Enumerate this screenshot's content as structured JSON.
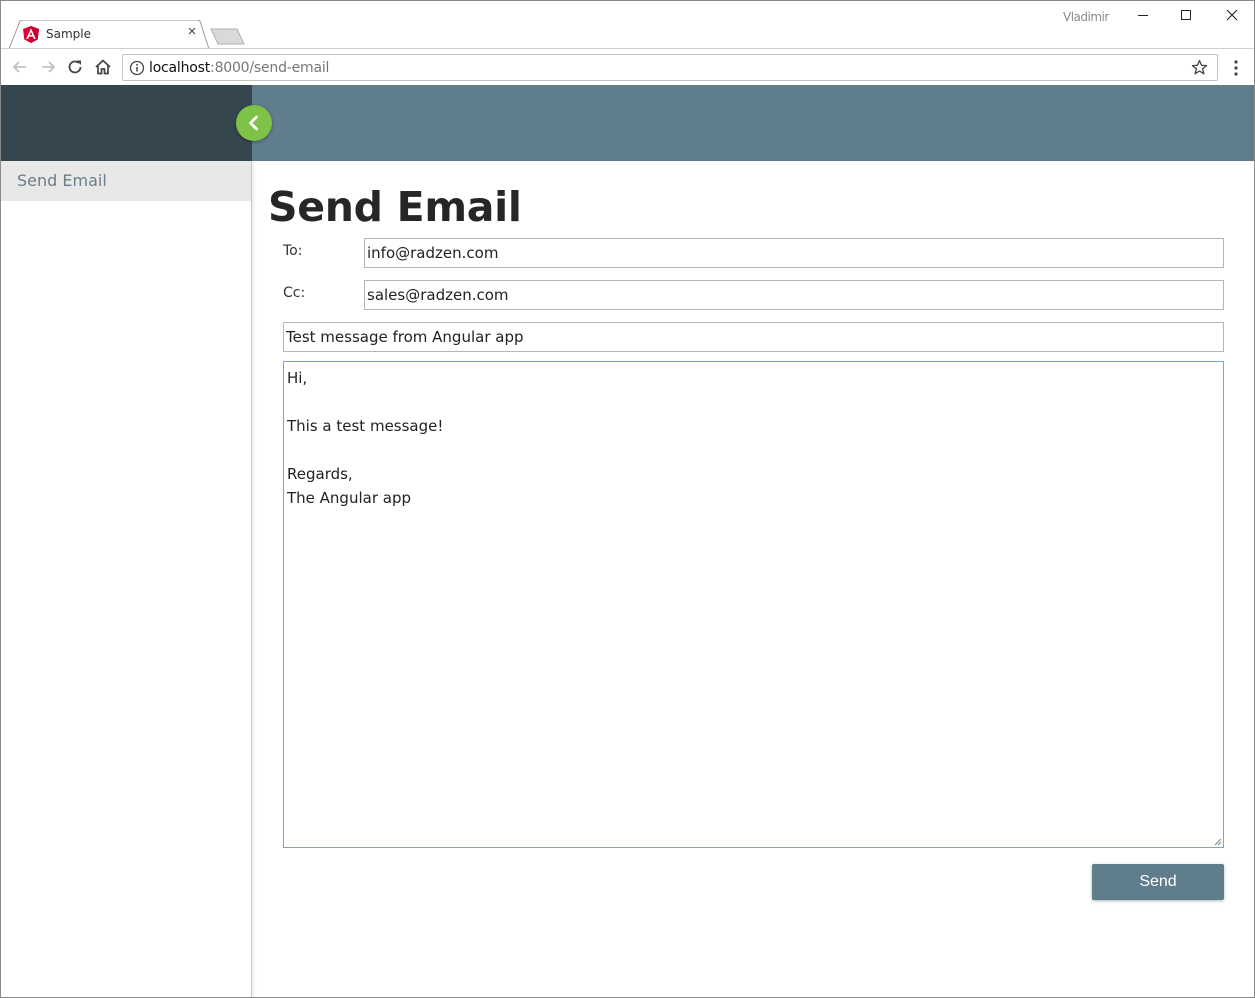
{
  "browser": {
    "tab_title": "Sample",
    "tab_close": "×",
    "user_name": "Vladimir",
    "url_host": "localhost",
    "url_rest": ":8000/send-email"
  },
  "sidebar": {
    "items": [
      {
        "label": "Send Email"
      }
    ]
  },
  "page": {
    "title": "Send Email"
  },
  "form": {
    "to_label": "To:",
    "to_value": "info@radzen.com",
    "cc_label": "Cc:",
    "cc_value": "sales@radzen.com",
    "subject_value": "Test message from Angular app",
    "body_value": "Hi,\n\nThis a test message!\n\nRegards,\nThe Angular app",
    "send_label": "Send"
  },
  "colors": {
    "header": "#607d8b",
    "sidebar_header": "#36464e",
    "toggle": "#7ec247"
  }
}
